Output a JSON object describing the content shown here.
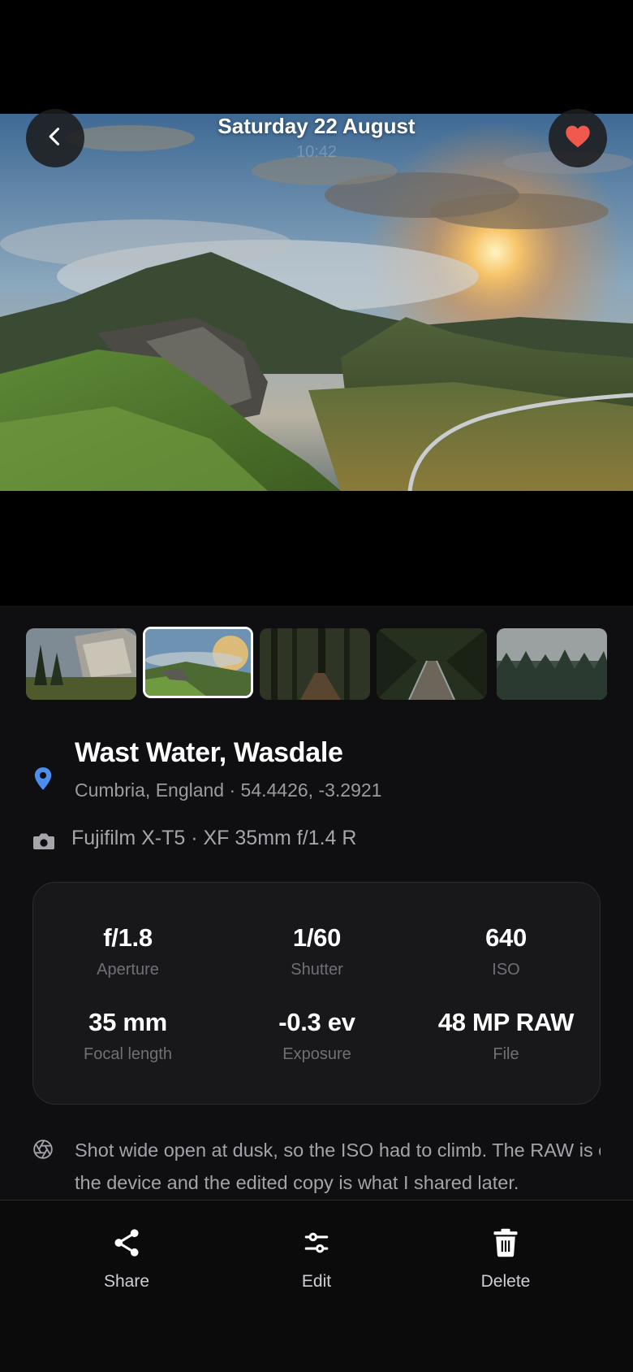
{
  "header": {
    "date": "Saturday 22 August",
    "time": "10:42"
  },
  "icons": {
    "back": "chevron-left-icon",
    "favorite": "heart-icon",
    "location": "map-pin-icon",
    "camera": "camera-icon",
    "note": "aperture-icon",
    "share": "share-icon",
    "edit": "sliders-icon",
    "delete": "trash-icon"
  },
  "colors": {
    "favorite": "#f0594b",
    "location_pin": "#4a8ef0",
    "panel_bg": "#0f0f11",
    "card_bg": "#18181b"
  },
  "filmstrip": {
    "selected_index": 1,
    "thumbnails": [
      {
        "subject": "valley-cliff"
      },
      {
        "subject": "green-hills-sunset"
      },
      {
        "subject": "forest-path"
      },
      {
        "subject": "boardwalk-forest"
      },
      {
        "subject": "misty-pines"
      }
    ]
  },
  "location": {
    "title": "Wast Water, Wasdale",
    "subtitle": "Cumbria, England · 54.4426, -3.2921"
  },
  "camera": {
    "text": "Fujifilm X-T5 · XF 35mm f/1.4 R"
  },
  "exif": [
    {
      "value": "f/1.8",
      "label": "Aperture"
    },
    {
      "value": "1/60",
      "label": "Shutter"
    },
    {
      "value": "640",
      "label": "ISO"
    },
    {
      "value": "35 mm",
      "label": "Focal length"
    },
    {
      "value": "-0.3 ev",
      "label": "Exposure"
    },
    {
      "value": "48 MP RAW",
      "label": "File"
    }
  ],
  "note": {
    "text": "Shot wide open at dusk, so the ISO had to climb. The RAW is on the device and the edited copy is what I shared later."
  },
  "actions": {
    "share": "Share",
    "edit": "Edit",
    "delete": "Delete"
  }
}
